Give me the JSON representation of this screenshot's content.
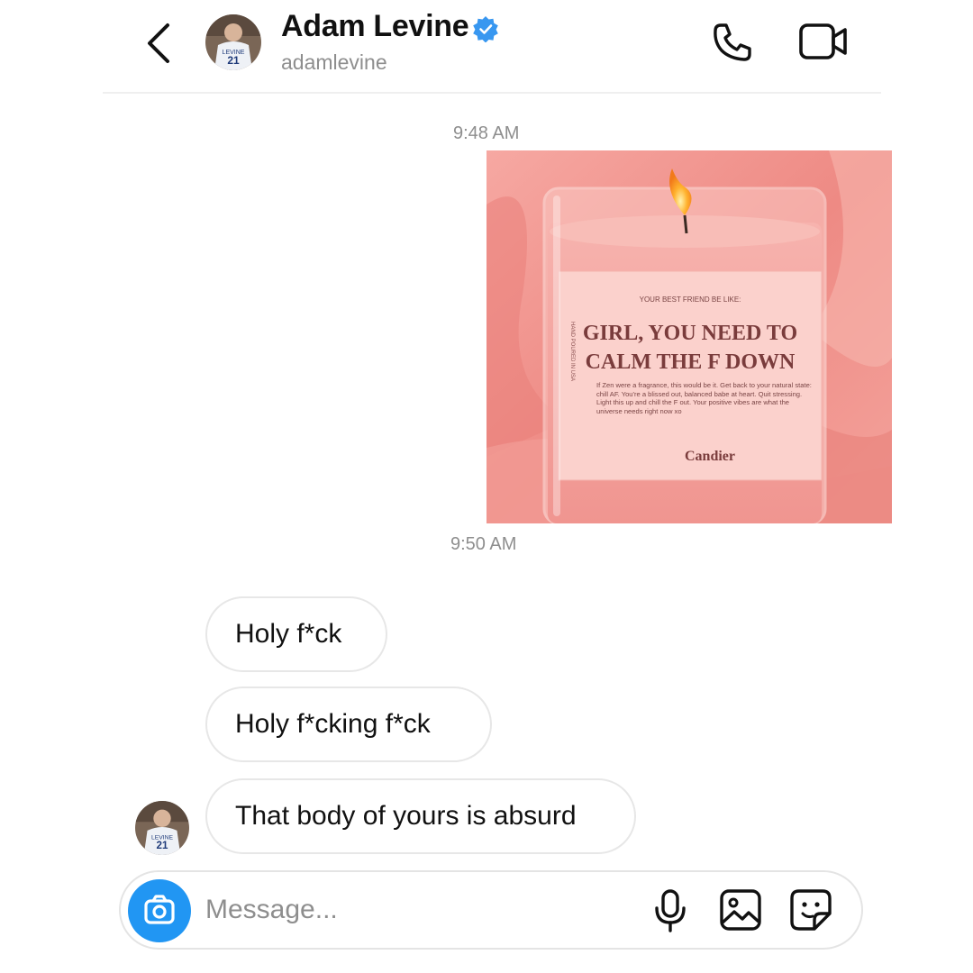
{
  "header": {
    "name": "Adam Levine",
    "handle": "adamlevine",
    "icons": {
      "back": "chevron-left-icon",
      "verified": "verified-badge-icon",
      "call": "phone-icon",
      "video": "video-camera-icon"
    }
  },
  "thread": {
    "timestamp_1": "9:48 AM",
    "timestamp_2": "9:50 AM",
    "photo": {
      "label_small": "YOUR BEST FRIEND BE LIKE:",
      "headline_1": "GIRL, YOU NEED TO",
      "headline_2": "CALM THE F DOWN",
      "body": "If Zen were a fragrance, this would be it. Get back to your natural state: chill AF. You're a blissed out, balanced babe at heart. Quit stressing. Light this up and chill the F out. Your positive vibes are what the universe needs right now xo",
      "brand": "Candier",
      "side_text": "HAND POURED IN USA"
    },
    "messages": [
      {
        "text": "Holy f*ck"
      },
      {
        "text": "Holy f*cking f*ck"
      },
      {
        "text": "That body of yours is absurd"
      }
    ]
  },
  "composer": {
    "placeholder": "Message...",
    "icons": {
      "camera": "camera-icon",
      "mic": "microphone-icon",
      "gallery": "image-gallery-icon",
      "sticker": "sticker-icon"
    }
  },
  "colors": {
    "accent_blue": "#2196f3",
    "verified_blue": "#3897f0",
    "muted_text": "#8e8e8e",
    "candle_pink": "#f08a86"
  }
}
